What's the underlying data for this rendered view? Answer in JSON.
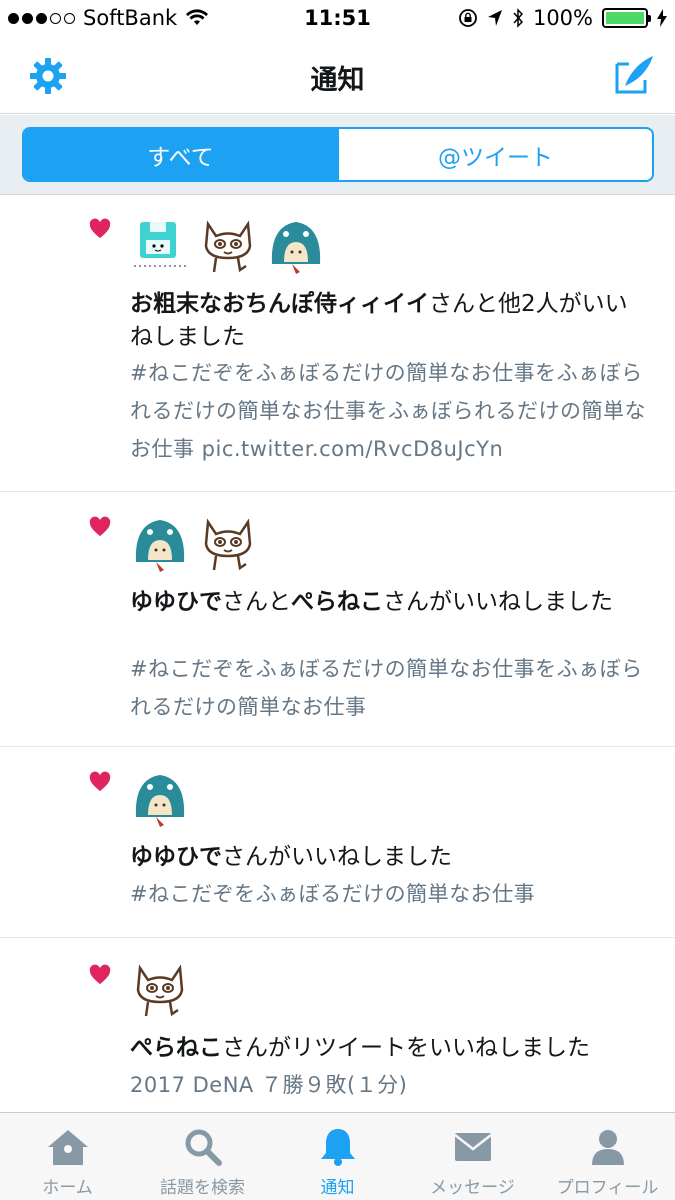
{
  "status_bar": {
    "carrier": "SoftBank",
    "time": "11:51",
    "battery": "100%"
  },
  "nav": {
    "title": "通知"
  },
  "segments": [
    {
      "label": "すべて",
      "active": true
    },
    {
      "label": "@ツイート",
      "active": false
    }
  ],
  "notifications": [
    {
      "names": [
        "お粗末なおちんぽ侍ィィイイ"
      ],
      "connector": "",
      "suffix": "さんと他2人がいいねしました",
      "tweet": "#ねこだぞをふぁぼるだけの簡単なお仕事をふぁぼられるだけの簡単なお仕事をふぁぼられるだけの簡単なお仕事 pic.twitter.com/RvcD8uJcYn",
      "avatars": [
        "floppy-avatar",
        "cat-avatar",
        "hood-avatar"
      ]
    },
    {
      "names": [
        "ゆゆひで",
        "ぺらねこ"
      ],
      "connector": "さんと",
      "suffix": "さんがいいねしました",
      "tweet": "#ねこだぞをふぁぼるだけの簡単なお仕事をふぁぼられるだけの簡単なお仕事",
      "avatars": [
        "hood-avatar",
        "cat-avatar"
      ]
    },
    {
      "names": [
        "ゆゆひで"
      ],
      "connector": "",
      "suffix": "さんがいいねしました",
      "tweet": "#ねこだぞをふぁぼるだけの簡単なお仕事",
      "avatars": [
        "hood-avatar"
      ]
    },
    {
      "names": [
        "ぺらねこ"
      ],
      "connector": "",
      "suffix": "さんがリツイートをいいねしました",
      "tweet": "2017 DeNA ７勝９敗(１分)",
      "avatars": [
        "cat-avatar"
      ]
    }
  ],
  "tabs": [
    {
      "label": "ホーム",
      "icon": "home-icon"
    },
    {
      "label": "話題を検索",
      "icon": "search-icon"
    },
    {
      "label": "通知",
      "icon": "bell-icon",
      "active": true
    },
    {
      "label": "メッセージ",
      "icon": "envelope-icon"
    },
    {
      "label": "プロフィール",
      "icon": "person-icon"
    }
  ],
  "colors": {
    "accent": "#1da1f2",
    "heart": "#e0245e",
    "muted": "#657786"
  }
}
